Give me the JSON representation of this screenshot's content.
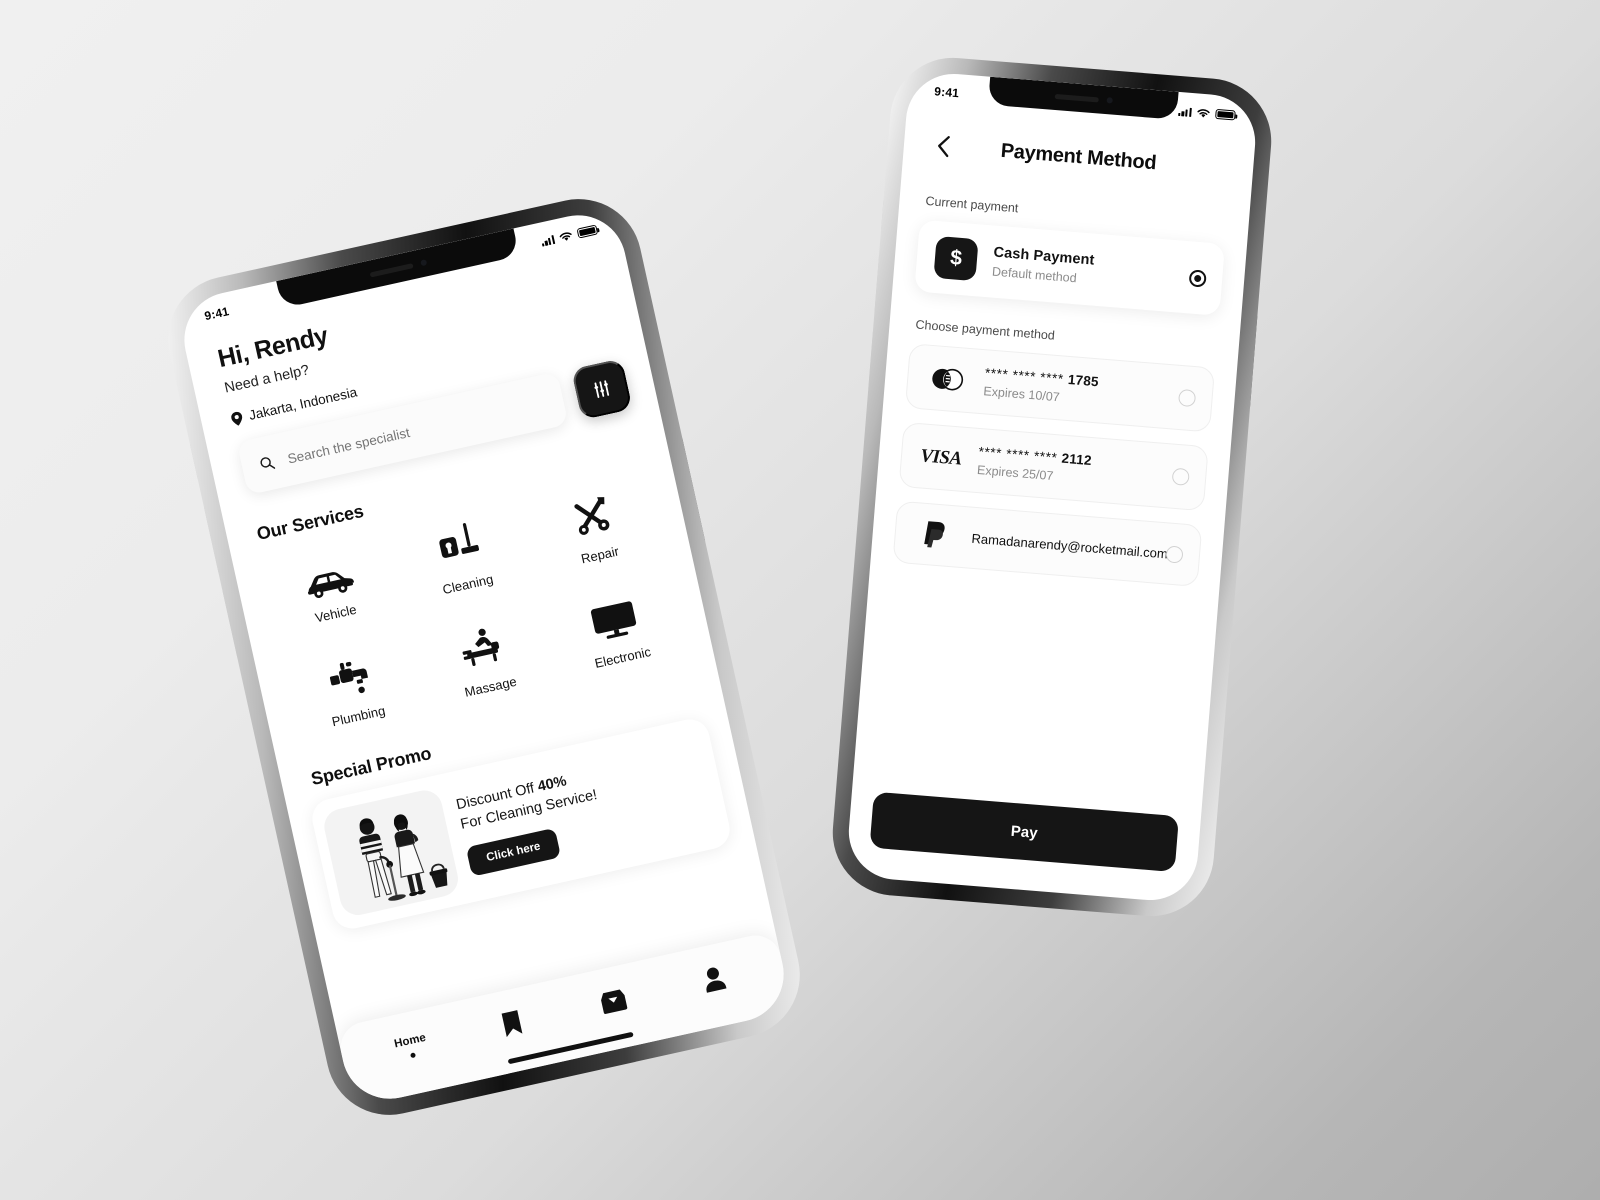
{
  "meta": {
    "background_top": "#f0f0f0",
    "background_bottom": "#aeaeae",
    "accent_dark": "#151515"
  },
  "phone_home": {
    "status_bar": {
      "time": "9:41",
      "signal_icon": "cellular-bars-icon",
      "wifi_icon": "wifi-icon",
      "battery_icon": "battery-full-icon"
    },
    "header": {
      "greeting": "Hi, Rendy",
      "subtitle": "Need a help?",
      "location": "Jakarta, Indonesia",
      "location_icon": "map-pin-icon"
    },
    "search": {
      "placeholder": "Search the specialist",
      "value": "",
      "search_icon": "search-icon",
      "filter_icon": "sliders-filter-icon"
    },
    "services": {
      "title": "Our Services",
      "items": [
        {
          "label": "Vehicle",
          "icon": "car-icon"
        },
        {
          "label": "Cleaning",
          "icon": "mop-bucket-icon"
        },
        {
          "label": "Repair",
          "icon": "wrench-screwdriver-icon"
        },
        {
          "label": "Plumbing",
          "icon": "faucet-icon"
        },
        {
          "label": "Massage",
          "icon": "massage-table-icon"
        },
        {
          "label": "Electronic",
          "icon": "monitor-icon"
        }
      ]
    },
    "promo": {
      "title": "Special Promo",
      "line1_prefix": "Discount Off ",
      "line1_strong": "40%",
      "line2": "For Cleaning Service!",
      "button_label": "Click here",
      "illustration": "two-cleaners-illustration"
    },
    "tabbar": {
      "items": [
        {
          "label": "Home",
          "icon": "home-active-dot-icon",
          "active": true
        },
        {
          "label": "",
          "icon": "bookmark-icon",
          "active": false
        },
        {
          "label": "",
          "icon": "inbox-icon",
          "active": false
        },
        {
          "label": "",
          "icon": "person-icon",
          "active": false
        }
      ]
    }
  },
  "phone_payment": {
    "status_bar": {
      "time": "9:41",
      "signal_icon": "cellular-bars-icon",
      "wifi_icon": "wifi-icon",
      "battery_icon": "battery-full-icon"
    },
    "header": {
      "title": "Payment Method",
      "back_icon": "chevron-left-icon"
    },
    "current_payment": {
      "section_label": "Current payment",
      "name": "Cash Payment",
      "subtitle": "Default method",
      "logo": "dollar-badge-icon",
      "logo_glyph": "$",
      "selected": true
    },
    "choose_payment": {
      "section_label": "Choose payment method",
      "methods": [
        {
          "logo": "mastercard-icon",
          "number": "**** **** **** ",
          "last4": "1785",
          "expiry": "Expires 10/07",
          "selected": false
        },
        {
          "logo": "visa-icon",
          "logo_text": "VISA",
          "number": "**** **** **** ",
          "last4": "2112",
          "expiry": "Expires 25/07",
          "selected": false
        },
        {
          "logo": "paypal-icon",
          "number": "Ramadanarendy@rocketmail.com",
          "last4": "",
          "expiry": "",
          "selected": false
        }
      ]
    },
    "footer": {
      "pay_button_label": "Pay"
    }
  }
}
